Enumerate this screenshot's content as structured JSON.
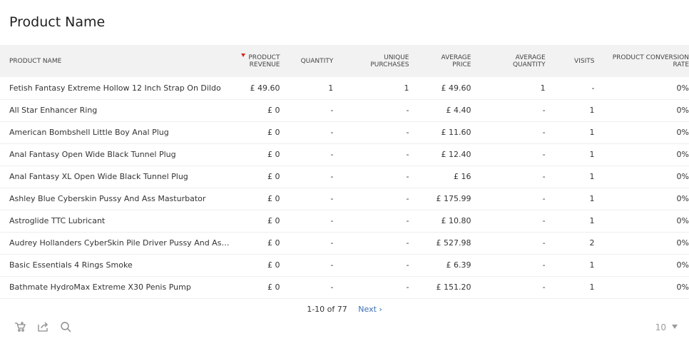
{
  "page": {
    "title": "Product Name"
  },
  "table": {
    "columns": [
      {
        "label": "PRODUCT NAME"
      },
      {
        "label": "PRODUCT REVENUE",
        "line1": "PRODUCT",
        "line2": "REVENUE",
        "sorted": "desc"
      },
      {
        "label": "QUANTITY"
      },
      {
        "label": "UNIQUE PURCHASES",
        "line1": "UNIQUE",
        "line2": "PURCHASES"
      },
      {
        "label": "AVERAGE PRICE",
        "line1": "AVERAGE",
        "line2": "PRICE"
      },
      {
        "label": "AVERAGE QUANTITY",
        "line1": "AVERAGE",
        "line2": "QUANTITY"
      },
      {
        "label": "VISITS"
      },
      {
        "label": "PRODUCT CONVERSION RATE",
        "line1": "PRODUCT CONVERSION",
        "line2": "RATE"
      }
    ],
    "rows": [
      {
        "name": "Fetish Fantasy Extreme Hollow 12 Inch Strap On Dildo",
        "revenue": "£ 49.60",
        "quantity": "1",
        "unique": "1",
        "avg_price": "£ 49.60",
        "avg_qty": "1",
        "visits": "-",
        "conversion": "0%"
      },
      {
        "name": "All Star Enhancer Ring",
        "revenue": "£ 0",
        "quantity": "-",
        "unique": "-",
        "avg_price": "£ 4.40",
        "avg_qty": "-",
        "visits": "1",
        "conversion": "0%"
      },
      {
        "name": "American Bombshell Little Boy Anal Plug",
        "revenue": "£ 0",
        "quantity": "-",
        "unique": "-",
        "avg_price": "£ 11.60",
        "avg_qty": "-",
        "visits": "1",
        "conversion": "0%"
      },
      {
        "name": "Anal Fantasy Open Wide Black Tunnel Plug",
        "revenue": "£ 0",
        "quantity": "-",
        "unique": "-",
        "avg_price": "£ 12.40",
        "avg_qty": "-",
        "visits": "1",
        "conversion": "0%"
      },
      {
        "name": "Anal Fantasy XL Open Wide Black Tunnel Plug",
        "revenue": "£ 0",
        "quantity": "-",
        "unique": "-",
        "avg_price": "£ 16",
        "avg_qty": "-",
        "visits": "1",
        "conversion": "0%"
      },
      {
        "name": "Ashley Blue Cyberskin Pussy And Ass Masturbator",
        "revenue": "£ 0",
        "quantity": "-",
        "unique": "-",
        "avg_price": "£ 175.99",
        "avg_qty": "-",
        "visits": "1",
        "conversion": "0%"
      },
      {
        "name": "Astroglide TTC Lubricant",
        "revenue": "£ 0",
        "quantity": "-",
        "unique": "-",
        "avg_price": "£ 10.80",
        "avg_qty": "-",
        "visits": "1",
        "conversion": "0%"
      },
      {
        "name": "Audrey Hollanders CyberSkin Pile Driver Pussy And Ass Mast...",
        "revenue": "£ 0",
        "quantity": "-",
        "unique": "-",
        "avg_price": "£ 527.98",
        "avg_qty": "-",
        "visits": "2",
        "conversion": "0%"
      },
      {
        "name": "Basic Essentials 4 Rings Smoke",
        "revenue": "£ 0",
        "quantity": "-",
        "unique": "-",
        "avg_price": "£ 6.39",
        "avg_qty": "-",
        "visits": "1",
        "conversion": "0%"
      },
      {
        "name": "Bathmate HydroMax Extreme X30 Penis Pump",
        "revenue": "£ 0",
        "quantity": "-",
        "unique": "-",
        "avg_price": "£ 151.20",
        "avg_qty": "-",
        "visits": "1",
        "conversion": "0%"
      }
    ]
  },
  "pagination": {
    "range": "1-10 of 77",
    "next": "Next ›"
  },
  "footer": {
    "icons": [
      "add-to-dashboard-icon",
      "export-icon",
      "search-icon"
    ],
    "limit": "10"
  },
  "colors": {
    "link": "#1a73c9",
    "sort_arrow": "#d4291f",
    "header_bg": "#f2f2f2"
  }
}
